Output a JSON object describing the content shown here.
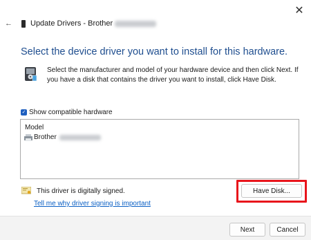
{
  "window": {
    "title_prefix": "Update Drivers - Brother",
    "close_glyph": "✕",
    "back_glyph": "←"
  },
  "heading": "Select the device driver you want to install for this hardware.",
  "description": "Select the manufacturer and model of your hardware device and then click Next. If you have a disk that contains the driver you want to install, click Have Disk.",
  "compatible": {
    "checked": true,
    "label": "Show compatible hardware"
  },
  "list": {
    "header": "Model",
    "items": [
      {
        "label": "Brother",
        "selected": false
      }
    ]
  },
  "signature": {
    "status": "This driver is digitally signed.",
    "link": "Tell me why driver signing is important"
  },
  "buttons": {
    "have_disk": "Have Disk...",
    "next": "Next",
    "cancel": "Cancel"
  },
  "colors": {
    "heading": "#1f4e8f",
    "link": "#0a5fc4",
    "highlight": "#e8141b",
    "checkbox": "#1e5fbf"
  }
}
